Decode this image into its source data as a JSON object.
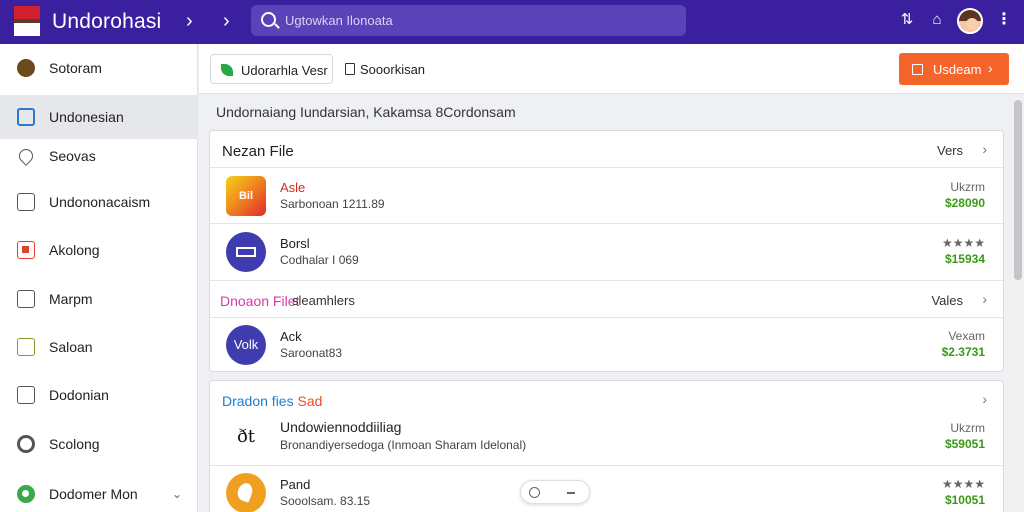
{
  "topbar": {
    "title": "Undorohasi",
    "search_placeholder": "Ugtowkan Ilonoata",
    "icons": [
      "flag-icon",
      "chevron-right-icon",
      "chevron-right-icon",
      "search-icon",
      "share-icon",
      "home-icon",
      "avatar",
      "more-vertical-icon"
    ],
    "bg_color": "#3a1f9e"
  },
  "sidebar": {
    "items": [
      {
        "label": "Sotoram",
        "icon": "coin-icon"
      },
      {
        "label": "Undonesian",
        "icon": "folder-icon",
        "active": true
      },
      {
        "label": "Seovas",
        "icon": "pin-icon"
      },
      {
        "label": "Undononacaism",
        "icon": "document-icon"
      },
      {
        "label": "Akolong",
        "icon": "red-square-icon"
      },
      {
        "label": "Marpm",
        "icon": "monitor-icon"
      },
      {
        "label": "Saloan",
        "icon": "green-grid-icon"
      },
      {
        "label": "Dodonian",
        "icon": "box-icon"
      },
      {
        "label": "Scolong",
        "icon": "ring-icon"
      },
      {
        "label": "Dodomer Mon",
        "icon": "green-circle-icon"
      }
    ]
  },
  "toolbar": {
    "btn1_label": "Udorarhla Vesr",
    "btn2_label": "Sooorkisan",
    "primary_label": "Usdeam",
    "primary_color": "#f5642a"
  },
  "content": {
    "subtitle": "Undornaiang Iundarsian, Kakamsa 8Cordonsam",
    "section1": {
      "title": "Nezan File",
      "right": "Vers",
      "rows": [
        {
          "logo_text": "Bil",
          "name": "Asle",
          "sub": "Sarbonoan 1211.89",
          "meta": "Ukzrm",
          "price": "$28090"
        },
        {
          "logo_text": "",
          "name": "Borsl",
          "sub": "Codhalar I 069",
          "meta": "★★★★",
          "price": "$15934"
        }
      ]
    },
    "section2": {
      "title": "Dnoaon Filet",
      "title2": "sleamhlers",
      "right": "Vales",
      "rows": [
        {
          "logo_text": "Volk",
          "name": "Ack",
          "sub": "Saroonat83",
          "meta": "Vexam",
          "price": "$2.3731"
        }
      ]
    },
    "section3": {
      "title": "Dradon fies",
      "title_accent": "Sad",
      "rows": [
        {
          "logo_text": "ðt",
          "name": "Undowiennoddiiliag",
          "sub": "Bronandiyersedoga (Inmoan Sharam Idelonal)",
          "meta": "Ukzrm",
          "price": "$59051"
        },
        {
          "logo_text": "",
          "name": "Pand",
          "sub": "Sooolsam. 83.15",
          "meta": "★★★★",
          "price": "$10051"
        }
      ]
    }
  }
}
